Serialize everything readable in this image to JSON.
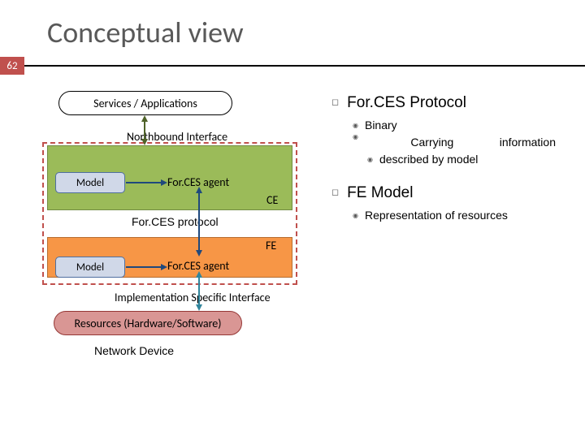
{
  "page": {
    "title": "Conceptual view",
    "number": "62"
  },
  "diagram": {
    "services": "Services / Applications",
    "northbound": "Northbound Interface",
    "ce": "CE",
    "fe": "FE",
    "model": "Model",
    "agent": "For.CES agent",
    "protocol": "For.CES protocol",
    "impl_iface": "Implementation Specific Interface",
    "resources": "Resources (Hardware/Software)",
    "device": "Network Device"
  },
  "bullets": {
    "proto": {
      "title": "For.CES Protocol",
      "b1": "Binary",
      "b2_a": "Carrying",
      "b2_b": "information",
      "b2_c": "described by model"
    },
    "model": {
      "title": "FE Model",
      "b1": "Representation of resources"
    }
  }
}
